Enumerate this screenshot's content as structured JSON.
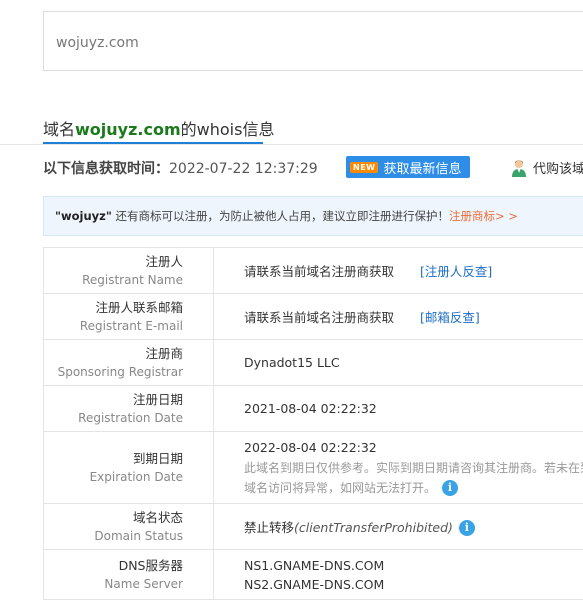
{
  "search": {
    "value": "wojuyz.com"
  },
  "title": {
    "prefix": "域名",
    "domain": "wojuyz.com",
    "suffix": "的whois信息"
  },
  "fetch": {
    "label": "以下信息获取时间：",
    "time": "2022-07-22 12:37:29",
    "new_badge": "NEW",
    "refresh_label": "获取最新信息",
    "buy_label": "代购该域"
  },
  "notice": {
    "domain": "\"wojuyz\"",
    "text": " 还有商标可以注册，为防止被他人占用，建议立即注册进行保护！",
    "link": "注册商标> >"
  },
  "rows": [
    {
      "cn": "注册人",
      "en": "Registrant Name",
      "value": "请联系当前域名注册商获取",
      "link": "[注册人反查]"
    },
    {
      "cn": "注册人联系邮箱",
      "en": "Registrant E-mail",
      "value": "请联系当前域名注册商获取",
      "link": "[邮箱反查]"
    },
    {
      "cn": "注册商",
      "en": "Sponsoring Registrar",
      "value": "Dynadot15 LLC"
    },
    {
      "cn": "注册日期",
      "en": "Registration Date",
      "value": "2021-08-04 02:22:32"
    },
    {
      "cn": "到期日期",
      "en": "Expiration Date",
      "value": "2022-08-04 02:22:32",
      "note1": "此域名到期日仅供参考。实际到期日期请咨询其注册商。若未在到期日",
      "note2": "域名访问将异常，如网站无法打开。"
    },
    {
      "cn": "域名状态",
      "en": "Domain Status",
      "value_cn": "禁止转移",
      "value_en": "(clientTransferProhibited)"
    },
    {
      "cn": "DNS服务器",
      "en": "Name Server",
      "ns1": "NS1.GNAME-DNS.COM",
      "ns2": "NS2.GNAME-DNS.COM"
    }
  ],
  "colors": {
    "accent": "#1e7fd8",
    "domain_green": "#1b7a1b",
    "button_blue": "#2e8de6",
    "link_orange": "#e8703a"
  }
}
